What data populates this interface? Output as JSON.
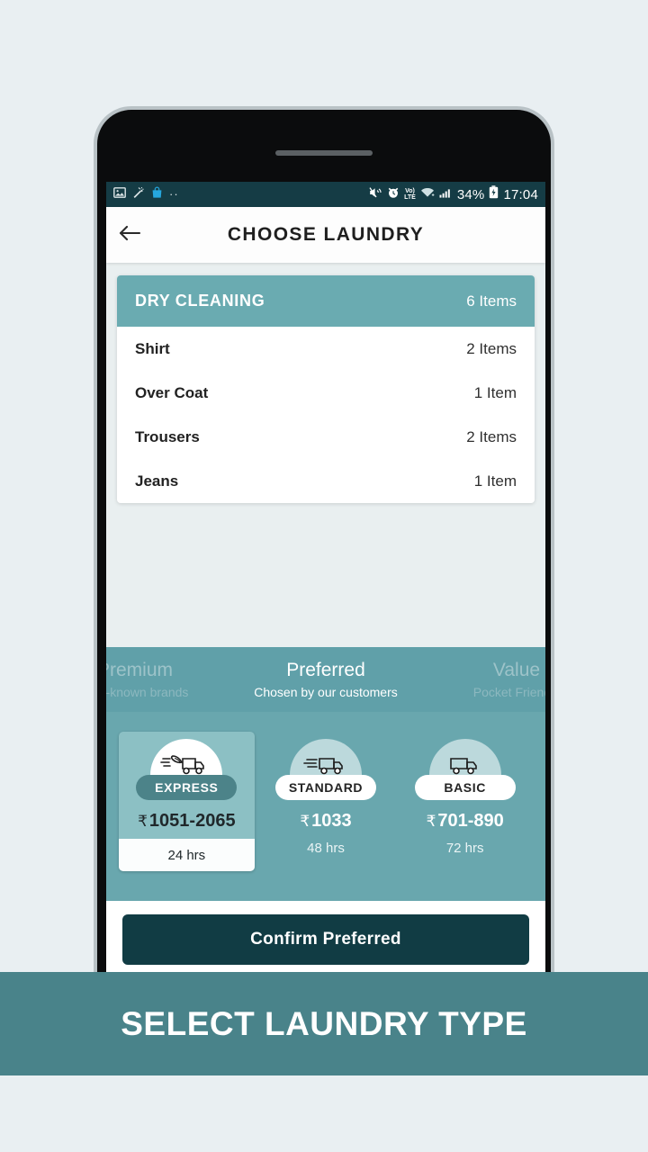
{
  "colors": {
    "page_bg": "#e9eff2",
    "statusbar_bg": "#153c45",
    "accent_teal": "#6aabb1",
    "plan_strip_bg": "#60a0a9",
    "speed_zone_bg": "#69a7ae",
    "selected_card_bg": "#8cc0c4",
    "confirm_btn_bg": "#113c44",
    "caption_bg": "#49838a"
  },
  "statusbar": {
    "left_icons": [
      "image-icon",
      "magic-wand-icon",
      "shopping-bag-icon",
      "more-dots-icon"
    ],
    "right_icons": [
      "mute-icon",
      "alarm-icon",
      "volte-icon",
      "wifi-icon",
      "signal-icon",
      "battery-icon"
    ],
    "volte_top": "Vo)",
    "volte_bottom": "LTE",
    "battery_percent": "34%",
    "clock": "17:04"
  },
  "appbar": {
    "back_icon": "back-arrow-icon",
    "title": "CHOOSE LAUNDRY"
  },
  "category": {
    "title": "DRY CLEANING",
    "count": "6 Items",
    "items": [
      {
        "name": "Shirt",
        "count": "2 Items"
      },
      {
        "name": "Over Coat",
        "count": "1 Item"
      },
      {
        "name": "Trousers",
        "count": "2 Items"
      },
      {
        "name": "Jeans",
        "count": "1 Item"
      }
    ]
  },
  "plan_tabs": [
    {
      "name": "Premium",
      "sub": "Well-known brands",
      "state": "partial-left"
    },
    {
      "name": "Preferred",
      "sub": "Chosen by our customers",
      "state": "active"
    },
    {
      "name": "Value",
      "sub": "Pocket Friendly",
      "state": "partial-right"
    }
  ],
  "speed_options": [
    {
      "id": "express",
      "label": "EXPRESS",
      "rupee": "₹",
      "price": "1051-2065",
      "eta": "24 hrs",
      "icon": "winged-truck-icon",
      "selected": true
    },
    {
      "id": "standard",
      "label": "STANDARD",
      "rupee": "₹",
      "price": "1033",
      "eta": "48 hrs",
      "icon": "fast-truck-icon",
      "selected": false
    },
    {
      "id": "basic",
      "label": "BASIC",
      "rupee": "₹",
      "price": "701-890",
      "eta": "72 hrs",
      "icon": "truck-icon",
      "selected": false
    }
  ],
  "confirm": {
    "label": "Confirm Preferred"
  },
  "caption": {
    "text": "SELECT LAUNDRY TYPE"
  }
}
